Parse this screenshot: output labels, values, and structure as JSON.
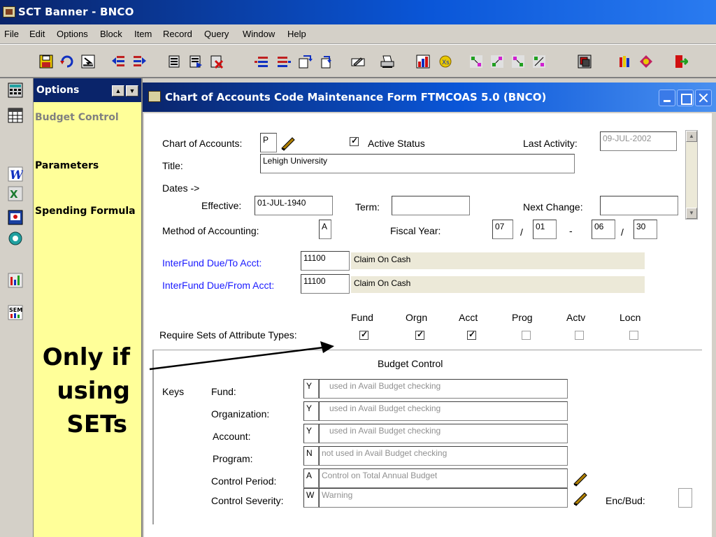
{
  "app": {
    "title": "SCT Banner - BNCO"
  },
  "menu": [
    "File",
    "Edit",
    "Options",
    "Block",
    "Item",
    "Record",
    "Query",
    "Window",
    "Help"
  ],
  "options_panel": {
    "title": "Options",
    "items": [
      "Budget Control",
      "Parameters",
      "Spending Formula"
    ]
  },
  "form": {
    "title": "Chart of Accounts Code Maintenance Form  FTMCOAS  5.0  (BNCO)",
    "chart_of_accounts_label": "Chart of Accounts:",
    "chart_of_accounts_value": "P",
    "active_status_label": "Active Status",
    "active_status_checked": true,
    "last_activity_label": "Last Activity:",
    "last_activity_value": "09-JUL-2002",
    "title_label": "Title:",
    "title_value": "Lehigh University",
    "dates_label": "Dates ->",
    "effective_label": "Effective:",
    "effective_value": "01-JUL-1940",
    "term_label": "Term:",
    "term_value": "",
    "next_change_label": "Next Change:",
    "next_change_value": "",
    "method_label": "Method of Accounting:",
    "method_value": "A",
    "fiscal_year_label": "Fiscal Year:",
    "fiscal_start_month": "07",
    "fiscal_start_day": "01",
    "fiscal_end_month": "06",
    "fiscal_end_day": "30",
    "slash": "/",
    "dash": "-",
    "interfund_to_label": "InterFund Due/To Acct:",
    "interfund_to_value": "11100",
    "interfund_to_desc": "Claim On Cash",
    "interfund_from_label": "InterFund Due/From Acct:",
    "interfund_from_value": "11100",
    "interfund_from_desc": "Claim On Cash",
    "require_sets_label": "Require Sets of Attribute Types:",
    "attr_types": [
      {
        "label": "Fund",
        "checked": true
      },
      {
        "label": "Orgn",
        "checked": true
      },
      {
        "label": "Acct",
        "checked": true
      },
      {
        "label": "Prog",
        "checked": false
      },
      {
        "label": "Actv",
        "checked": false
      },
      {
        "label": "Locn",
        "checked": false
      }
    ],
    "budget_control_title": "Budget Control",
    "keys_label": "Keys",
    "budget_rows": [
      {
        "label": "Fund:",
        "code": "Y",
        "desc": "used in Avail Budget checking"
      },
      {
        "label": "Organization:",
        "code": "Y",
        "desc": "used in Avail Budget checking"
      },
      {
        "label": "Account:",
        "code": "Y",
        "desc": "used in Avail Budget checking"
      },
      {
        "label": "Program:",
        "code": "N",
        "desc": "not used in Avail Budget checking"
      },
      {
        "label": "Control Period:",
        "code": "A",
        "desc": "Control on Total Annual Budget"
      },
      {
        "label": "Control Severity:",
        "code": "W",
        "desc": "Warning"
      }
    ],
    "enc_bud_label": "Enc/Bud:"
  },
  "annotation": {
    "line1": "Only if",
    "line2": "using",
    "line3": "SETs"
  }
}
